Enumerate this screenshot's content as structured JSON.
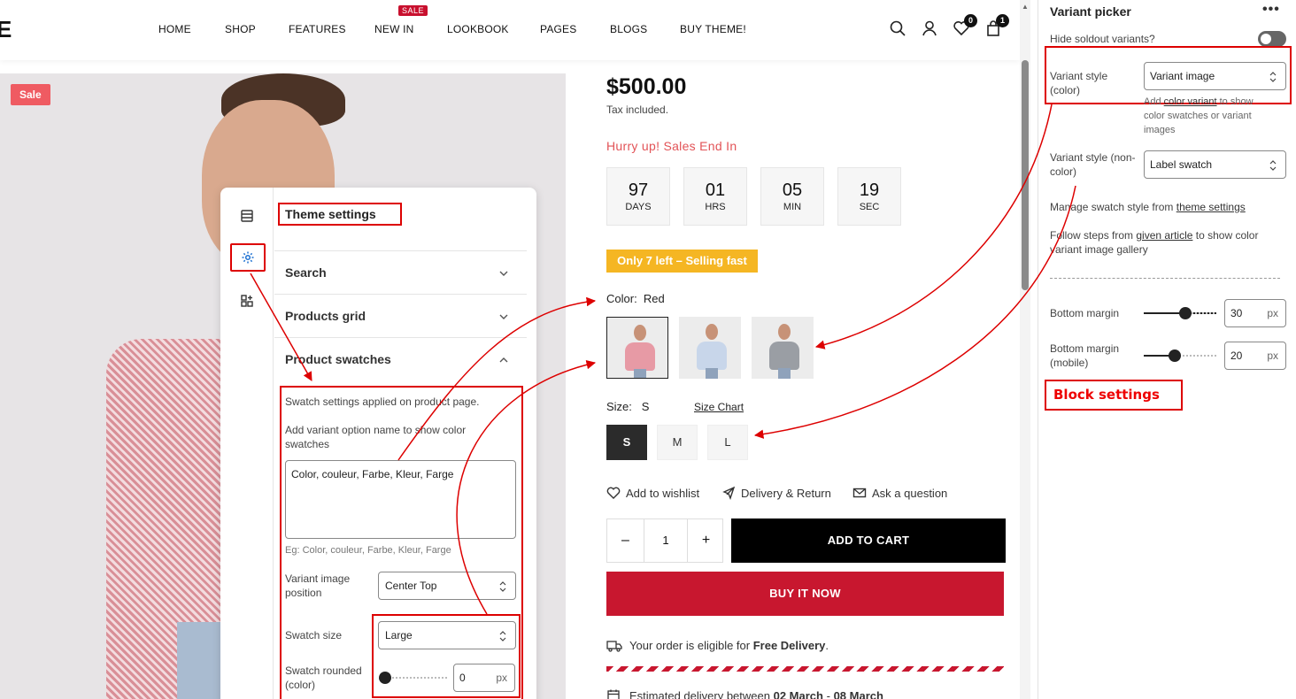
{
  "store": {
    "logo": "E",
    "nav": [
      "HOME",
      "SHOP",
      "FEATURES",
      "NEW IN",
      "LOOKBOOK",
      "PAGES",
      "BLOGS",
      "BUY THEME!"
    ],
    "sale_flag": "SALE",
    "wishlist_count": "0",
    "cart_count": "1",
    "sale_badge": "Sale"
  },
  "theme_settings": {
    "title": "Theme settings",
    "sections": [
      "Search",
      "Products grid",
      "Product swatches"
    ],
    "swatch_desc": "Swatch settings applied on product page.",
    "variant_option_label": "Add variant option name to show color swatches",
    "variant_option_value": "Color, couleur, Farbe, Kleur, Farge",
    "variant_option_hint": "Eg: Color, couleur, Farbe, Kleur, Farge",
    "image_position_label": "Variant image position",
    "image_position_value": "Center Top",
    "swatch_size_label": "Swatch size",
    "swatch_size_value": "Large",
    "swatch_rounded_label": "Swatch rounded (color)",
    "swatch_rounded_value": "0",
    "unit": "px"
  },
  "product": {
    "price": "$500.00",
    "tax": "Tax included.",
    "hurry": "Hurry up! Sales End In",
    "countdown": [
      {
        "value": "97",
        "label": "DAYS"
      },
      {
        "value": "01",
        "label": "HRS"
      },
      {
        "value": "05",
        "label": "MIN"
      },
      {
        "value": "19",
        "label": "SEC"
      }
    ],
    "stock": "Only 7 left – Selling fast",
    "color_label": "Color:",
    "color_value": "Red",
    "swatch_colors": [
      "#e79aa5",
      "#c8d6ea",
      "#9a9ea4"
    ],
    "size_label": "Size:",
    "size_value": "S",
    "size_chart": "Size Chart",
    "sizes": [
      "S",
      "M",
      "L"
    ],
    "actions": [
      "Add to wishlist",
      "Delivery & Return",
      "Ask a question"
    ],
    "qty": "1",
    "add_to_cart": "ADD TO CART",
    "buy_now": "BUY IT NOW",
    "eligible_prefix": "Your order is eligible for",
    "eligible_bold": "Free Delivery",
    "eligible_suffix": ".",
    "delivery_prefix": "Estimated delivery between",
    "delivery_from": "02 March",
    "delivery_sep": "-",
    "delivery_to": "08 March"
  },
  "editor": {
    "title": "Variant picker",
    "hide_soldout": "Hide soldout variants?",
    "style_color_label": "Variant style (color)",
    "style_color_value": "Variant image",
    "style_color_hint_pre": "Add",
    "style_color_hint_link": "color variant",
    "style_color_hint_post": "to show color swatches or variant images",
    "style_noncolor_label": "Variant style (non-color)",
    "style_noncolor_value": "Label swatch",
    "manage_pre": "Manage swatch style from",
    "manage_link": "theme settings",
    "follow_pre": "Follow steps from",
    "follow_link": "given article",
    "follow_post": "to show color variant image gallery",
    "bottom_margin_label": "Bottom margin",
    "bottom_margin_value": "30",
    "bottom_margin_mobile_label": "Bottom margin (mobile)",
    "bottom_margin_mobile_value": "20",
    "unit": "px",
    "block_settings": "Block settings"
  },
  "colors": {
    "annotation_red": "#dd0000",
    "buy_now": "#c8172f",
    "stock_badge": "#f5b623",
    "hurry_text": "#e25357"
  }
}
